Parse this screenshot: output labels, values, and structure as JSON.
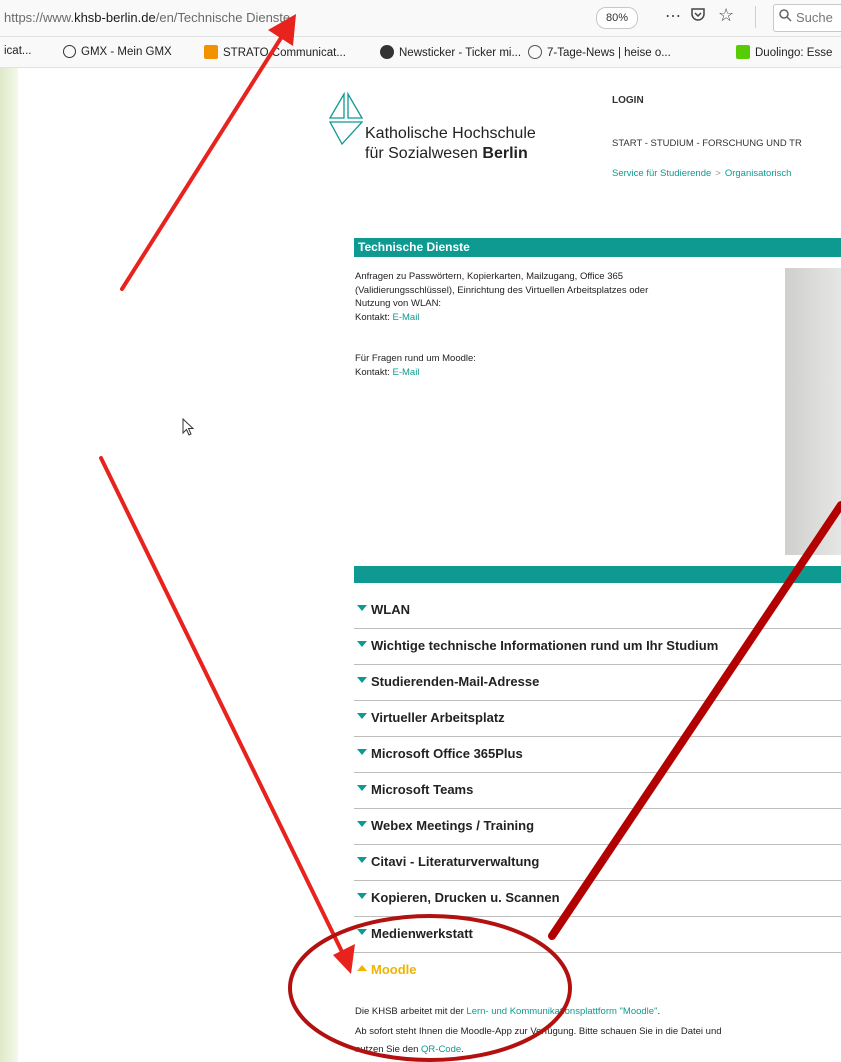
{
  "browser": {
    "url_prefix": "https://www.",
    "url_host": "khsb-berlin.de",
    "url_path": "/en/Technische Dienste",
    "zoom": "80%",
    "search_placeholder": "Suche",
    "bookmarks": [
      {
        "label": "icat...",
        "color": ""
      },
      {
        "label": "GMX - Mein GMX",
        "color": "#1c449b"
      },
      {
        "label": "STRATO Communicat...",
        "color": "#f39200"
      },
      {
        "label": "Newsticker - Ticker mi...",
        "color": "#333333"
      },
      {
        "label": "7-Tage-News | heise o...",
        "color": "#555555"
      },
      {
        "label": "Duolingo: Esse",
        "color": "#58cc02"
      }
    ]
  },
  "site": {
    "logo_line1": "Katholische Hochschule",
    "logo_line2_a": "für Sozialwesen ",
    "logo_line2_b": "Berlin",
    "login": "LOGIN",
    "nav": "START  - STUDIUM  - FORSCHUNG UND TR",
    "breadcrumb": [
      "Service für Studierende",
      "Organisatorisch"
    ]
  },
  "section": {
    "title": "Technische Dienste",
    "p1_lines": [
      "Anfragen zu Passwörtern, Kopierkarten, Mailzugang, Office 365",
      "(Validierungsschlüssel), Einrichtung des Virtuellen Arbeitsplatzes oder",
      "Nutzung von WLAN:"
    ],
    "contact_label": "Kontakt: ",
    "contact_link": "E-Mail",
    "p2_line": "Für Fragen rund um Moodle:"
  },
  "accordion": [
    "WLAN",
    "Wichtige technische Informationen rund um Ihr Studium",
    "Studierenden-Mail-Adresse",
    "Virtueller Arbeitsplatz",
    "Microsoft Office 365Plus",
    "Microsoft Teams",
    "Webex Meetings / Training",
    "Citavi - Literaturverwaltung",
    "Kopieren, Drucken u. Scannen",
    "Medienwerkstatt",
    "Moodle"
  ],
  "moodle": {
    "line1_a": "Die KHSB arbeitet mit der ",
    "line1_link": "Lern- und Kommunikationsplattform \"Moodle\"",
    "line1_b": ".",
    "line2": "Ab sofort steht Ihnen die Moodle-App zur Verfügung. Bitte schauen Sie in die Datei und",
    "line3_a": "nutzen Sie den ",
    "line3_link": "QR-Code",
    "line3_b": "."
  },
  "annotations": {
    "arrow_color": "#e8231e",
    "line_color": "#b30000",
    "circle_color": "#b31010"
  }
}
